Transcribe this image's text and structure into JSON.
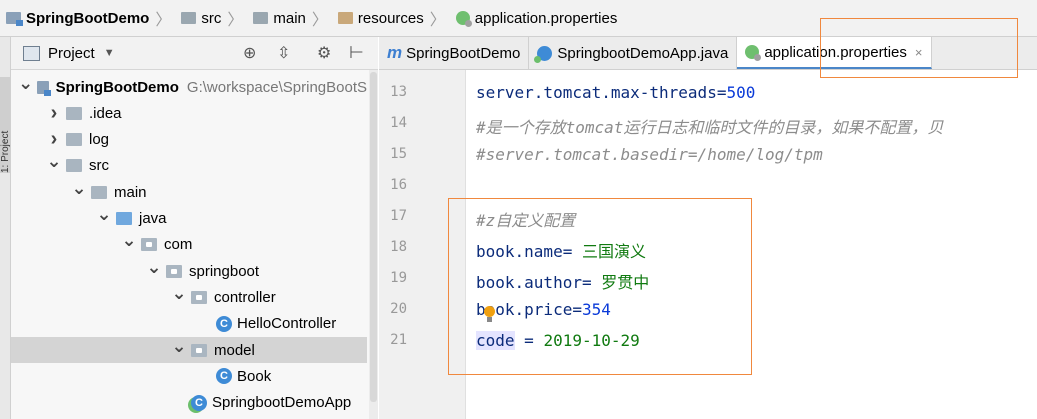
{
  "breadcrumb": [
    {
      "label": "SpringBootDemo",
      "icon": "module-folder-icon",
      "bold": true
    },
    {
      "label": "src",
      "icon": "folder-icon"
    },
    {
      "label": "main",
      "icon": "folder-icon"
    },
    {
      "label": "resources",
      "icon": "resources-folder-icon"
    },
    {
      "label": "application.properties",
      "icon": "spring-leaf-icon"
    }
  ],
  "strip_tab": "1: Project",
  "panel": {
    "title": "Project"
  },
  "tree": [
    {
      "label": "SpringBootDemo",
      "path": "G:\\workspace\\SpringBootS",
      "indent": 0,
      "arrow": "down",
      "icon": "mod",
      "bold": true
    },
    {
      "label": ".idea",
      "indent": 1,
      "arrow": "right",
      "icon": "folder"
    },
    {
      "label": "log",
      "indent": 1,
      "arrow": "right",
      "icon": "folder"
    },
    {
      "label": "src",
      "indent": 1,
      "arrow": "down",
      "icon": "folder"
    },
    {
      "label": "main",
      "indent": 2,
      "arrow": "down",
      "icon": "folder"
    },
    {
      "label": "java",
      "indent": 3,
      "arrow": "down",
      "icon": "blue"
    },
    {
      "label": "com",
      "indent": 4,
      "arrow": "down",
      "icon": "pkg"
    },
    {
      "label": "springboot",
      "indent": 5,
      "arrow": "down",
      "icon": "pkg"
    },
    {
      "label": "controller",
      "indent": 6,
      "arrow": "down",
      "icon": "pkg"
    },
    {
      "label": "HelloController",
      "indent": 7,
      "arrow": "",
      "icon": "class"
    },
    {
      "label": "model",
      "indent": 6,
      "arrow": "down",
      "icon": "pkg",
      "selected": true
    },
    {
      "label": "Book",
      "indent": 7,
      "arrow": "",
      "icon": "class"
    },
    {
      "label": "SpringbootDemoApp",
      "indent": 6,
      "arrow": "",
      "icon": "app"
    }
  ],
  "tabs": [
    {
      "label": "SpringBootDemo",
      "icon": "module-m-icon",
      "prefix": "m"
    },
    {
      "label": "SpringbootDemoApp.java",
      "icon": "class-icon"
    },
    {
      "label": "application.properties",
      "icon": "spring-leaf-icon",
      "active": true,
      "close": "×"
    }
  ],
  "editor": {
    "lines": [
      {
        "num": "13",
        "parts": [
          {
            "t": "server.tomcat.max-threads",
            "c": "k"
          },
          {
            "t": "=",
            "c": "k"
          },
          {
            "t": "500",
            "c": "n"
          }
        ]
      },
      {
        "num": "14",
        "parts": [
          {
            "t": "#是一个存放tomcat运行日志和临时文件的目录，如果不配置，贝",
            "c": "c"
          }
        ]
      },
      {
        "num": "15",
        "parts": [
          {
            "t": "#server.tomcat.basedir=/home/log/tpm",
            "c": "c"
          }
        ]
      },
      {
        "num": "16",
        "parts": []
      },
      {
        "num": "17",
        "parts": [
          {
            "t": "#z自定义配置",
            "c": "c"
          }
        ]
      },
      {
        "num": "18",
        "parts": [
          {
            "t": "book.name",
            "c": "k"
          },
          {
            "t": "= ",
            "c": "k"
          },
          {
            "t": "三国演义",
            "c": "v"
          }
        ]
      },
      {
        "num": "19",
        "parts": [
          {
            "t": "book.author",
            "c": "k"
          },
          {
            "t": "= ",
            "c": "k"
          },
          {
            "t": "罗贯中",
            "c": "v"
          }
        ]
      },
      {
        "num": "20",
        "parts": [
          {
            "t": "book.price",
            "c": "k"
          },
          {
            "t": "=",
            "c": "k"
          },
          {
            "t": "354",
            "c": "n"
          }
        ]
      },
      {
        "num": "21",
        "parts": [
          {
            "t": "code",
            "c": "k hl"
          },
          {
            "t": " = ",
            "c": "k"
          },
          {
            "t": "2019-10-29",
            "c": "v"
          }
        ]
      }
    ]
  },
  "colors": {
    "accent": "#4a86c8",
    "annotation": "#f0883e",
    "current_line": "#fffae3"
  }
}
